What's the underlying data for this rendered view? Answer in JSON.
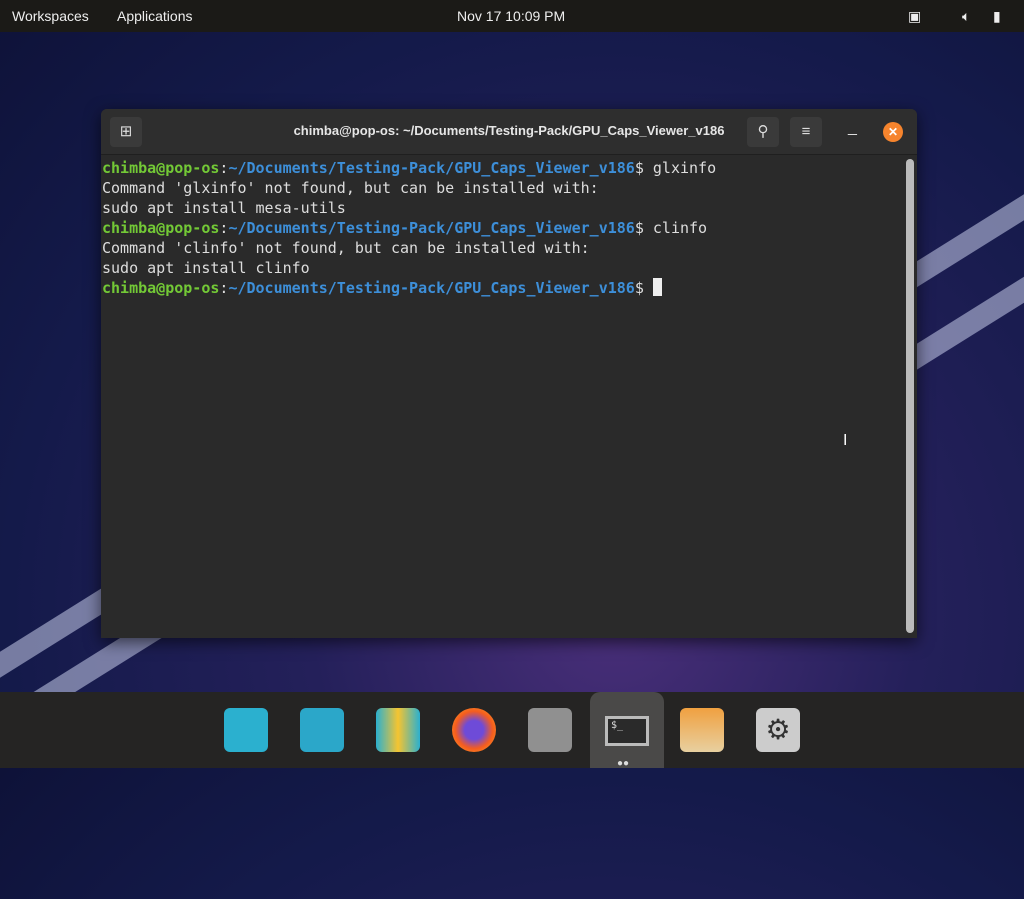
{
  "topbar": {
    "workspaces": "Workspaces",
    "applications": "Applications",
    "clock": "Nov 17  10:09 PM"
  },
  "window": {
    "title": "chimba@pop-os: ~/Documents/Testing-Pack/GPU_Caps_Viewer_v186"
  },
  "terminal": {
    "user": "chimba@pop-os",
    "path": "~/Documents/Testing-Pack/GPU_Caps_Viewer_v186",
    "lines": [
      {
        "type": "prompt",
        "cmd": "glxinfo"
      },
      {
        "type": "out",
        "text": "Command 'glxinfo' not found, but can be installed with:"
      },
      {
        "type": "out",
        "text": "sudo apt install mesa-utils"
      },
      {
        "type": "prompt",
        "cmd": "clinfo"
      },
      {
        "type": "out",
        "text": "Command 'clinfo' not found, but can be installed with:"
      },
      {
        "type": "out",
        "text": "sudo apt install clinfo"
      }
    ]
  },
  "dock": [
    "search-launcher",
    "window-tiling",
    "app-library",
    "firefox",
    "files",
    "terminal",
    "pop-shop",
    "settings"
  ],
  "colors": {
    "accent": "#f6842d",
    "prompt_user": "#73c936",
    "prompt_path": "#3d8fd9"
  }
}
